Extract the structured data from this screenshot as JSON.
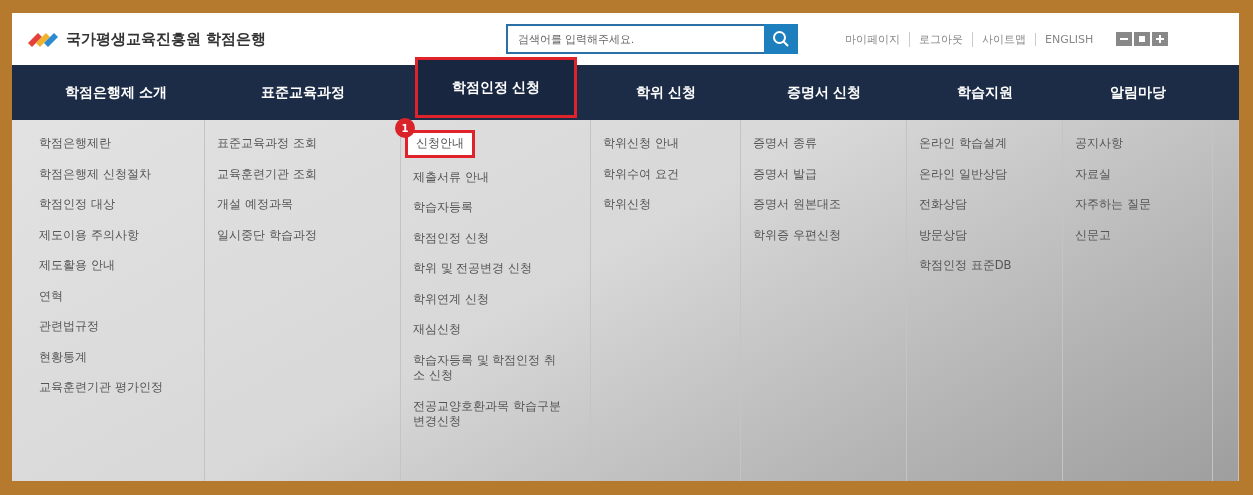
{
  "header": {
    "logo": "국가평생교육진흥원 학점은행",
    "search": {
      "placeholder": "검색어를 입력해주세요."
    },
    "links": [
      "마이페이지",
      "로그아웃",
      "사이트맵",
      "ENGLISH"
    ]
  },
  "nav": [
    {
      "label": "학점은행제 소개",
      "selected": false,
      "items": [
        {
          "label": "학점은행제란",
          "selected": false
        },
        {
          "label": "학점은행제 신청절차",
          "selected": false
        },
        {
          "label": "학점인정 대상",
          "selected": false
        },
        {
          "label": "제도이용 주의사항",
          "selected": false
        },
        {
          "label": "제도활용 안내",
          "selected": false
        },
        {
          "label": "연혁",
          "selected": false
        },
        {
          "label": "관련법규정",
          "selected": false
        },
        {
          "label": "현황통계",
          "selected": false
        },
        {
          "label": "교육훈련기관 평가인정",
          "selected": false
        }
      ]
    },
    {
      "label": "표준교육과정",
      "selected": false,
      "items": [
        {
          "label": "표준교육과정 조회",
          "selected": false
        },
        {
          "label": "교육훈련기관 조회",
          "selected": false
        },
        {
          "label": "개설 예정과목",
          "selected": false
        },
        {
          "label": "일시중단 학습과정",
          "selected": false
        }
      ]
    },
    {
      "label": "학점인정 신청",
      "selected": true,
      "items": [
        {
          "label": "신청안내",
          "selected": true,
          "badge": "1"
        },
        {
          "label": "제출서류 안내",
          "selected": false
        },
        {
          "label": "학습자등록",
          "selected": false
        },
        {
          "label": "학점인정 신청",
          "selected": false
        },
        {
          "label": "학위 및 전공변경 신청",
          "selected": false
        },
        {
          "label": "학위연계 신청",
          "selected": false
        },
        {
          "label": "재심신청",
          "selected": false
        },
        {
          "label": "학습자등록 및 학점인정 취소 신청",
          "selected": false
        },
        {
          "label": "전공교양호환과목 학습구분 변경신청",
          "selected": false
        }
      ]
    },
    {
      "label": "학위 신청",
      "selected": false,
      "items": [
        {
          "label": "학위신청 안내",
          "selected": false
        },
        {
          "label": "학위수여 요건",
          "selected": false
        },
        {
          "label": "학위신청",
          "selected": false
        }
      ]
    },
    {
      "label": "증명서 신청",
      "selected": false,
      "items": [
        {
          "label": "증명서 종류",
          "selected": false
        },
        {
          "label": "증명서 발급",
          "selected": false
        },
        {
          "label": "증명서 원본대조",
          "selected": false
        },
        {
          "label": "학위증 우편신청",
          "selected": false
        }
      ]
    },
    {
      "label": "학습지원",
      "selected": false,
      "items": [
        {
          "label": "온라인 학습설계",
          "selected": false
        },
        {
          "label": "온라인 일반상담",
          "selected": false
        },
        {
          "label": "전화상담",
          "selected": false
        },
        {
          "label": "방문상담",
          "selected": false
        },
        {
          "label": "학점인정 표준DB",
          "selected": false
        }
      ]
    },
    {
      "label": "알림마당",
      "selected": false,
      "items": [
        {
          "label": "공지사항",
          "selected": false
        },
        {
          "label": "자료실",
          "selected": false
        },
        {
          "label": "자주하는 질문",
          "selected": false
        },
        {
          "label": "신문고",
          "selected": false
        }
      ]
    }
  ]
}
